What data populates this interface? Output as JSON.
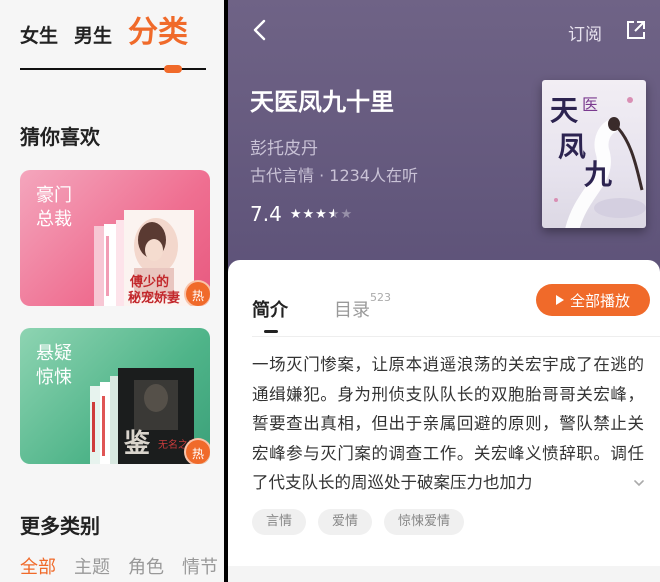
{
  "left": {
    "gender_tabs": [
      "女生",
      "男生",
      "分类"
    ],
    "guess_title": "猜你喜欢",
    "cards": [
      {
        "label": "豪门总裁",
        "badge": "热",
        "color": "#ef6f91"
      },
      {
        "label": "悬疑惊悚",
        "badge": "热",
        "color": "#4fb489"
      }
    ],
    "more_title": "更多类别",
    "categories": [
      "全部",
      "主题",
      "角色",
      "情节"
    ],
    "accent": "#f06a2a"
  },
  "right": {
    "subscribe": "订阅",
    "book_title": "天医凤九十里",
    "author": "彭托皮丹",
    "meta": "古代言情 · 1234人在听",
    "rating": "7.4",
    "rating_stars": 3.5,
    "tabs": {
      "intro": "简介",
      "toc": "目录",
      "toc_count": "523"
    },
    "play_all": "全部播放",
    "description": "一场灭门惨案，让原本逍遥浪荡的关宏宇成了在逃的通缉嫌犯。身为刑侦支队队长的双胞胎哥哥关宏峰，誓要查出真相，但出于亲属回避的原则，警队禁止关宏峰参与灭门案的调查工作。关宏峰义愤辞职。调任了代支队长的周巡处于破案压力也加力",
    "tags": [
      "言情",
      "爱情",
      "惊悚爱情"
    ]
  }
}
